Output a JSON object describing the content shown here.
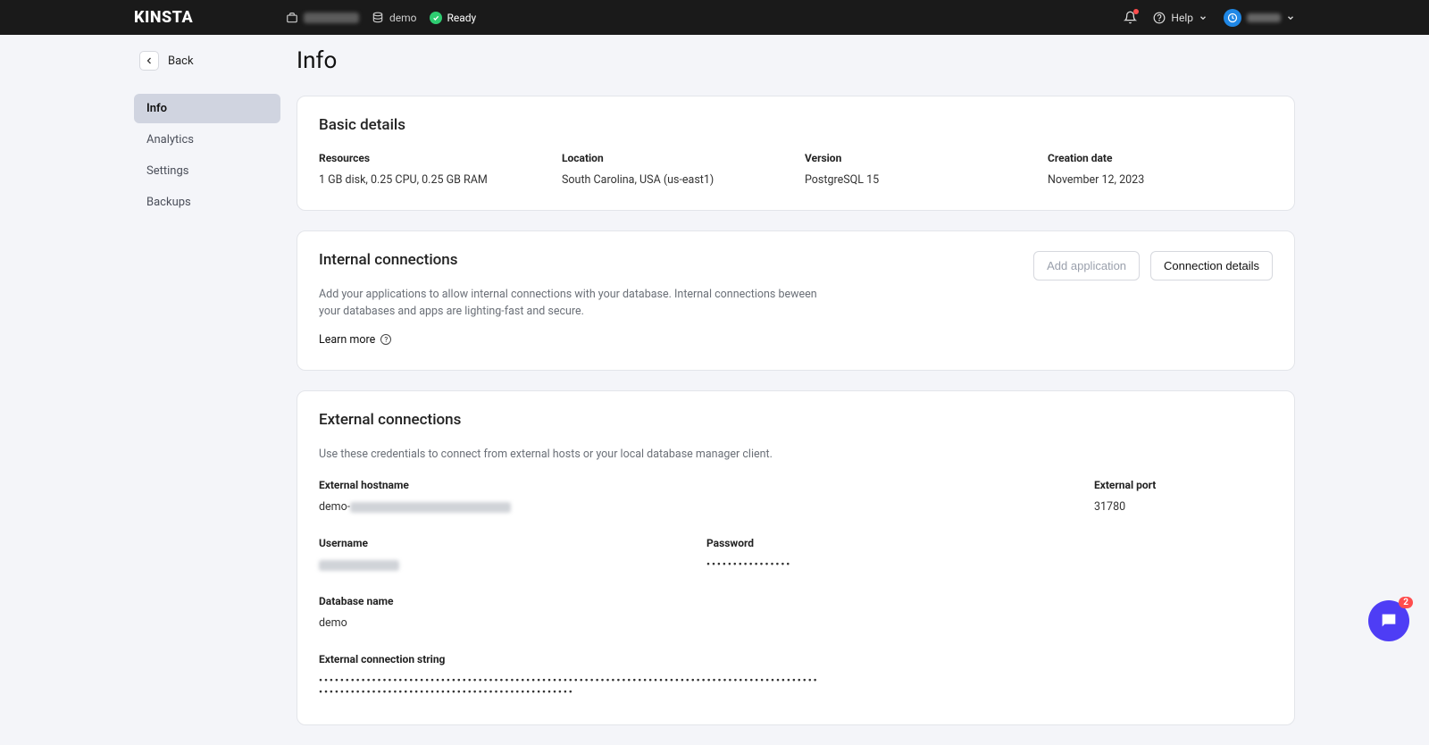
{
  "brand": "KINSTA",
  "topbar": {
    "project_name": "demo",
    "status": "Ready",
    "help_label": "Help"
  },
  "nav": {
    "back_label": "Back",
    "items": [
      "Info",
      "Analytics",
      "Settings",
      "Backups"
    ],
    "active_index": 0
  },
  "page_title": "Info",
  "basic": {
    "heading": "Basic details",
    "cols": [
      {
        "label": "Resources",
        "value": "1 GB disk, 0.25 CPU, 0.25 GB RAM"
      },
      {
        "label": "Location",
        "value": "South Carolina, USA (us-east1)"
      },
      {
        "label": "Version",
        "value": "PostgreSQL 15"
      },
      {
        "label": "Creation date",
        "value": "November 12, 2023"
      }
    ]
  },
  "internal": {
    "heading": "Internal connections",
    "desc": "Add your applications to allow internal connections with your database. Internal connections beween your databases and apps are lighting-fast and secure.",
    "learn_more": "Learn more",
    "add_app_btn": "Add application",
    "details_btn": "Connection details"
  },
  "external": {
    "heading": "External connections",
    "desc": "Use these credentials to connect from external hosts or your local database manager client.",
    "hostname_label": "External hostname",
    "hostname_prefix": "demo-",
    "port_label": "External port",
    "port_value": "31780",
    "username_label": "Username",
    "password_label": "Password",
    "password_mask": "••••••••••••••••",
    "dbname_label": "Database name",
    "dbname_value": "demo",
    "connstr_label": "External connection string",
    "connstr_mask": "••••••••••••••••••••••••••••••••••••••••••••••••••••••••••••••••••••••••••••••••••••••••••••••••••••••••••••••••••••••••••••••••••••••••••••••"
  },
  "chat_badge": "2"
}
